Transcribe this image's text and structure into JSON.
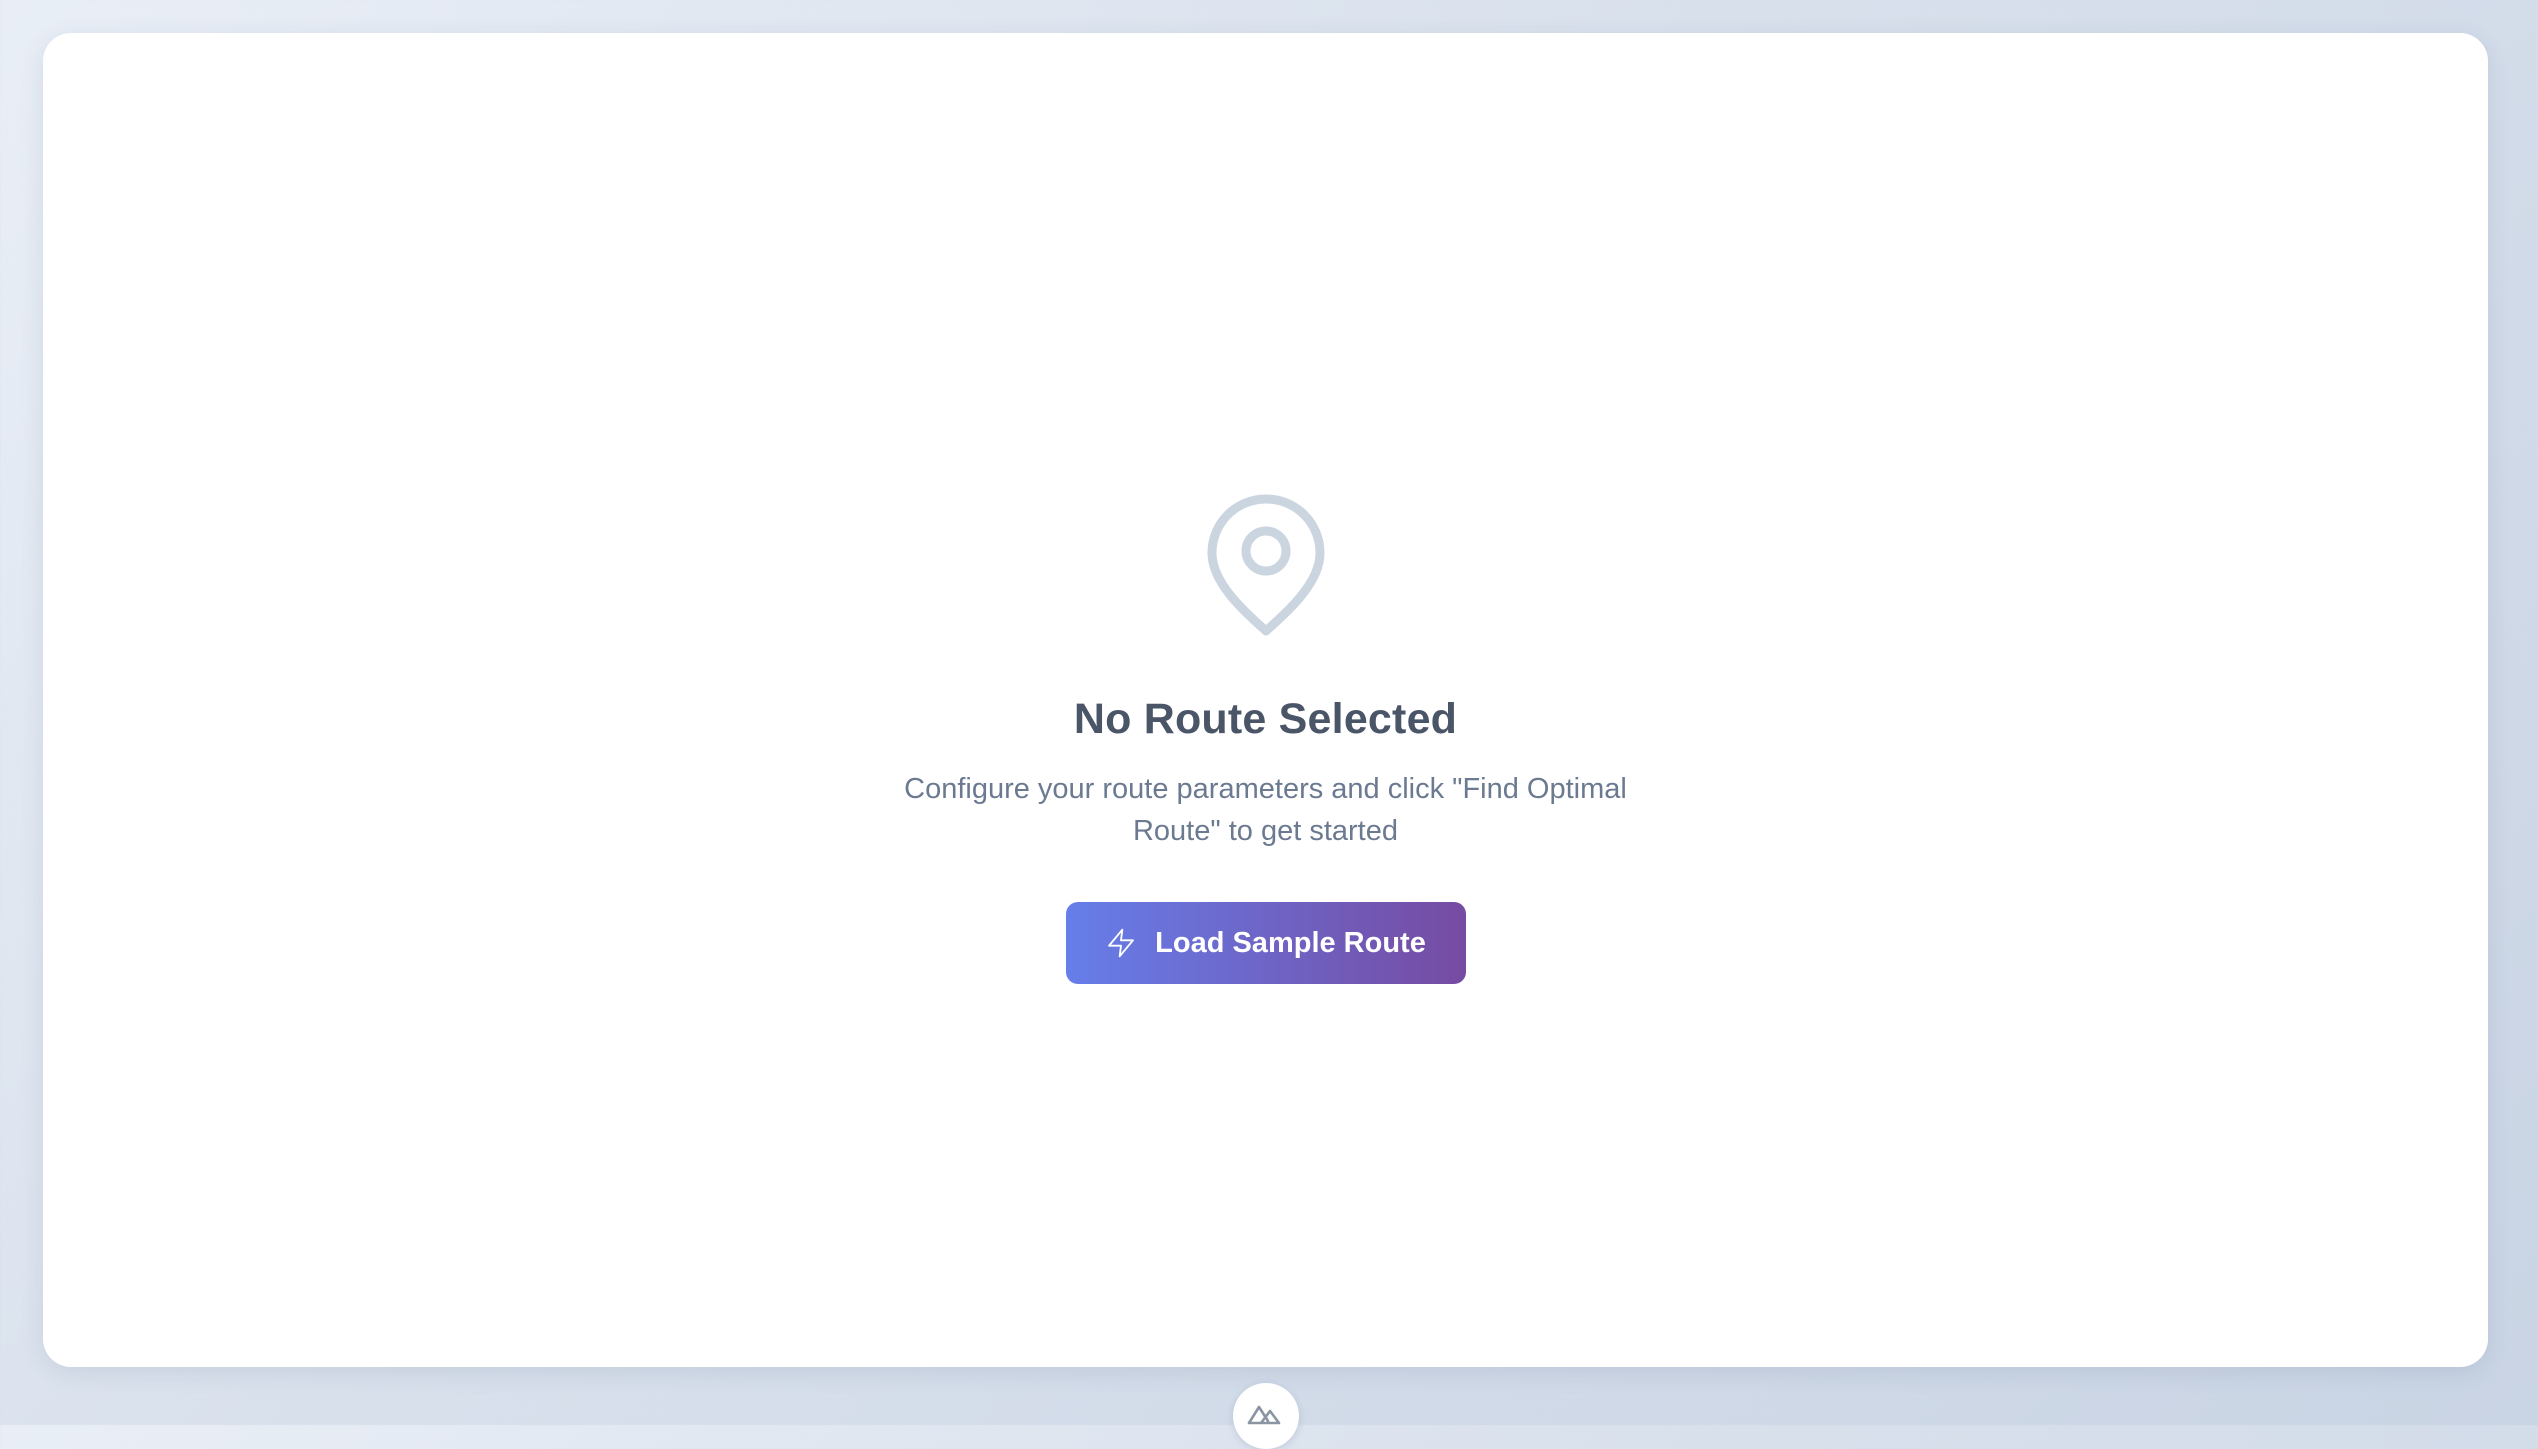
{
  "empty_state": {
    "icon": "map-pin-icon",
    "title": "No Route Selected",
    "description": "Configure your route parameters and click \"Find Optimal Route\" to get started",
    "button": {
      "label": "Load Sample Route",
      "icon": "lightning-bolt-icon"
    }
  },
  "footer": {
    "badge_icon": "mountain-logo-icon"
  },
  "colors": {
    "button_gradient_start": "#667eea",
    "button_gradient_end": "#764ba2",
    "title": "#4a5568",
    "description": "#6b7a90",
    "icon": "#cbd5e0"
  }
}
